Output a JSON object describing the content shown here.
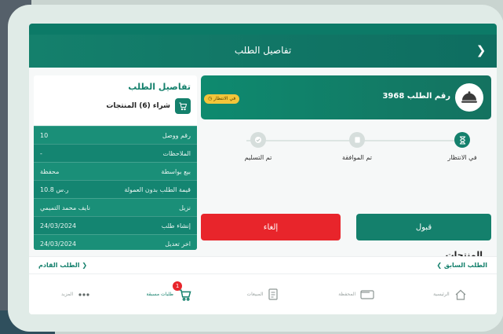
{
  "header": {
    "title": "تفاصيل الطلب"
  },
  "info_panel": {
    "title": "تفاصيل الطلب",
    "purchase_label": "شراء (6) المنتجات",
    "rows": [
      {
        "label": "رقم ووصل",
        "value": "10"
      },
      {
        "label": "الملاحظات",
        "value": "-"
      },
      {
        "label": "بيع بواسطة",
        "value": "محفظة"
      },
      {
        "label": "قيمة الطلب بدون العمولة",
        "value": "10.8 ر.س"
      },
      {
        "label": "نزيل",
        "value": "نايف محمد التميمي"
      },
      {
        "label": "إنشاء طلب",
        "value": "24/03/2024"
      },
      {
        "label": "اخر تعديل",
        "value": "24/03/2024"
      }
    ]
  },
  "order_card": {
    "order_number": "رقم الطلب 3968",
    "status_badge": "في الانتظار"
  },
  "stepper": {
    "steps": [
      {
        "label": "في الانتظار",
        "active": true
      },
      {
        "label": "تم الموافقة",
        "active": false
      },
      {
        "label": "تم التسليم",
        "active": false
      }
    ]
  },
  "actions": {
    "accept_label": "قبول",
    "cancel_label": "إلغاء"
  },
  "products": {
    "title": "المنتجات"
  },
  "pager": {
    "previous_label": "❮ الطلب السابق",
    "next_label": "الطلب القادم ❯"
  },
  "bottom_nav": {
    "items": [
      {
        "label": "الرئيسية",
        "icon": "home-icon"
      },
      {
        "label": "المحفظة",
        "icon": "wallet-icon"
      },
      {
        "label": "المبيعات",
        "icon": "receipt-icon"
      },
      {
        "label": "طلبات مسبقة",
        "icon": "cart-icon",
        "badge": "1",
        "active": true
      },
      {
        "label": "المزيد",
        "icon": "more-icon"
      }
    ]
  },
  "colors": {
    "primary": "#14806c",
    "danger": "#e8252b",
    "warning": "#f3c53a"
  }
}
